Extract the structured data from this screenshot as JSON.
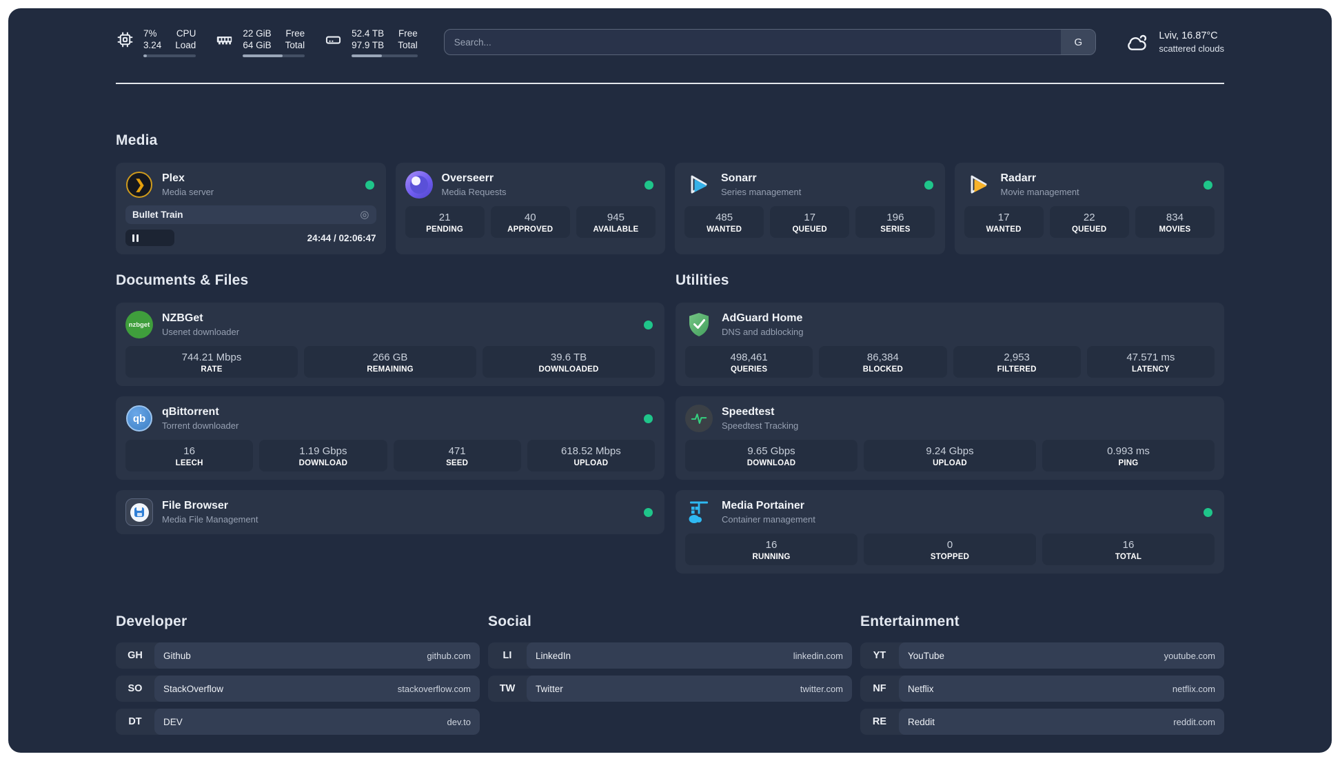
{
  "header": {
    "cpu": {
      "icon": "cpu-icon",
      "values": [
        "7%",
        "3.24"
      ],
      "labels": [
        "CPU",
        "Load"
      ],
      "progress": 7
    },
    "memory": {
      "icon": "memory-icon",
      "values": [
        "22 GiB",
        "64 GiB"
      ],
      "labels": [
        "Free",
        "Total"
      ],
      "progress": 64
    },
    "disk": {
      "icon": "disk-icon",
      "values": [
        "52.4 TB",
        "97.9 TB"
      ],
      "labels": [
        "Free",
        "Total"
      ],
      "progress": 46
    },
    "search": {
      "placeholder": "Search...",
      "button_label": "G"
    },
    "weather": {
      "icon": "cloud-icon",
      "location": "Lviv, 16.87°C",
      "condition": "scattered clouds"
    }
  },
  "colors": {
    "status_online": "#1fc58a",
    "plex": "#e5a00d",
    "sonarr": "#36b1e8",
    "radarr": "#f7b32b",
    "nzbget": "#3f9e3c",
    "qbittorrent": "#4a8fd4",
    "adguard": "#4f9e5f",
    "speedtest": "#35d07f",
    "portainer": "#2fb9f2"
  },
  "media": {
    "title": "Media",
    "apps": [
      {
        "name": "Plex",
        "desc": "Media server",
        "icon": "plex-icon",
        "online": true,
        "now_playing": {
          "title": "Bullet Train",
          "time": "24:44 / 02:06:47",
          "progress": 19.5
        }
      },
      {
        "name": "Overseerr",
        "desc": "Media Requests",
        "icon": "overseerr-icon",
        "online": true,
        "stats": [
          {
            "value": "21",
            "label": "PENDING"
          },
          {
            "value": "40",
            "label": "APPROVED"
          },
          {
            "value": "945",
            "label": "AVAILABLE"
          }
        ]
      },
      {
        "name": "Sonarr",
        "desc": "Series management",
        "icon": "sonarr-icon",
        "online": true,
        "stats": [
          {
            "value": "485",
            "label": "WANTED"
          },
          {
            "value": "17",
            "label": "QUEUED"
          },
          {
            "value": "196",
            "label": "SERIES"
          }
        ]
      },
      {
        "name": "Radarr",
        "desc": "Movie management",
        "icon": "radarr-icon",
        "online": true,
        "stats": [
          {
            "value": "17",
            "label": "WANTED"
          },
          {
            "value": "22",
            "label": "QUEUED"
          },
          {
            "value": "834",
            "label": "MOVIES"
          }
        ]
      }
    ]
  },
  "documents": {
    "title": "Documents & Files",
    "apps": [
      {
        "name": "NZBGet",
        "desc": "Usenet downloader",
        "icon": "nzbget-icon",
        "online": true,
        "stats": [
          {
            "value": "744.21 Mbps",
            "label": "RATE"
          },
          {
            "value": "266 GB",
            "label": "REMAINING"
          },
          {
            "value": "39.6 TB",
            "label": "DOWNLOADED"
          }
        ]
      },
      {
        "name": "qBittorrent",
        "desc": "Torrent downloader",
        "icon": "qbittorrent-icon",
        "online": true,
        "stats": [
          {
            "value": "16",
            "label": "LEECH"
          },
          {
            "value": "1.19 Gbps",
            "label": "DOWNLOAD"
          },
          {
            "value": "471",
            "label": "SEED"
          },
          {
            "value": "618.52 Mbps",
            "label": "UPLOAD"
          }
        ]
      },
      {
        "name": "File Browser",
        "desc": "Media File Management",
        "icon": "filebrowser-icon",
        "online": true,
        "stats": []
      }
    ]
  },
  "utilities": {
    "title": "Utilities",
    "apps": [
      {
        "name": "AdGuard Home",
        "desc": "DNS and adblocking",
        "icon": "adguard-icon",
        "online": false,
        "stats": [
          {
            "value": "498,461",
            "label": "QUERIES"
          },
          {
            "value": "86,384",
            "label": "BLOCKED"
          },
          {
            "value": "2,953",
            "label": "FILTERED"
          },
          {
            "value": "47.571 ms",
            "label": "LATENCY"
          }
        ]
      },
      {
        "name": "Speedtest",
        "desc": "Speedtest Tracking",
        "icon": "speedtest-icon",
        "online": false,
        "stats": [
          {
            "value": "9.65 Gbps",
            "label": "DOWNLOAD"
          },
          {
            "value": "9.24 Gbps",
            "label": "UPLOAD"
          },
          {
            "value": "0.993 ms",
            "label": "PING"
          }
        ]
      },
      {
        "name": "Media Portainer",
        "desc": "Container management",
        "icon": "portainer-icon",
        "online": true,
        "stats": [
          {
            "value": "16",
            "label": "RUNNING"
          },
          {
            "value": "0",
            "label": "STOPPED"
          },
          {
            "value": "16",
            "label": "TOTAL"
          }
        ]
      }
    ]
  },
  "links": {
    "developer": {
      "title": "Developer",
      "items": [
        {
          "abbr": "GH",
          "name": "Github",
          "url": "github.com"
        },
        {
          "abbr": "SO",
          "name": "StackOverflow",
          "url": "stackoverflow.com"
        },
        {
          "abbr": "DT",
          "name": "DEV",
          "url": "dev.to"
        }
      ]
    },
    "social": {
      "title": "Social",
      "items": [
        {
          "abbr": "LI",
          "name": "LinkedIn",
          "url": "linkedin.com"
        },
        {
          "abbr": "TW",
          "name": "Twitter",
          "url": "twitter.com"
        }
      ]
    },
    "entertainment": {
      "title": "Entertainment",
      "items": [
        {
          "abbr": "YT",
          "name": "YouTube",
          "url": "youtube.com"
        },
        {
          "abbr": "NF",
          "name": "Netflix",
          "url": "netflix.com"
        },
        {
          "abbr": "RE",
          "name": "Reddit",
          "url": "reddit.com"
        }
      ]
    }
  }
}
